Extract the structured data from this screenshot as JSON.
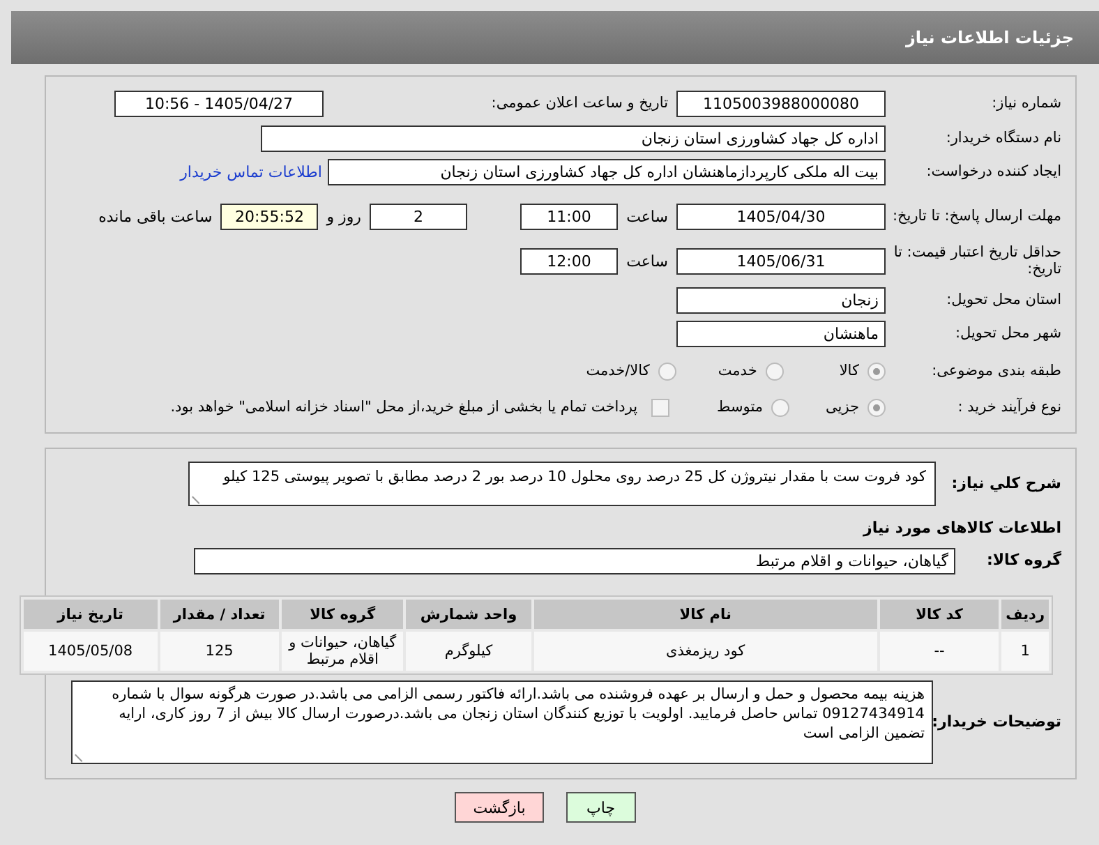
{
  "header": {
    "title": "جزئیات اطلاعات نیاز"
  },
  "need_number": {
    "label": "شماره نیاز:",
    "value": "1105003988000080"
  },
  "announce": {
    "label": "تاریخ و ساعت اعلان عمومی:",
    "value": "1405/04/27 - 10:56"
  },
  "buyer_org": {
    "label": "نام دستگاه خریدار:",
    "value": "اداره کل جهاد کشاورزی استان زنجان"
  },
  "requester": {
    "label": "ایجاد کننده درخواست:",
    "value": "بیت اله ملکی کارپردازماهنشان اداره کل جهاد کشاورزی استان زنجان",
    "link": "اطلاعات تماس خریدار"
  },
  "reply_deadline": {
    "label": "مهلت ارسال پاسخ: تا تاریخ:",
    "date": "1405/04/30",
    "time_label": "ساعت",
    "time": "11:00",
    "days": "2",
    "days_label": "روز و",
    "remaining": "20:55:52",
    "remaining_label": "ساعت باقی مانده"
  },
  "price_validity": {
    "label": "حداقل تاریخ اعتبار قیمت: تا تاریخ:",
    "date": "1405/06/31",
    "time_label": "ساعت",
    "time": "12:00"
  },
  "province": {
    "label": "استان محل تحویل:",
    "value": "زنجان"
  },
  "city": {
    "label": "شهر محل تحویل:",
    "value": "ماهنشان"
  },
  "category": {
    "label": "طبقه بندی موضوعی:",
    "options": [
      {
        "label": "کالا",
        "selected": true
      },
      {
        "label": "خدمت",
        "selected": false
      },
      {
        "label": "کالا/خدمت",
        "selected": false
      }
    ]
  },
  "purchase_process": {
    "label": "نوع فرآیند خرید :",
    "options": [
      {
        "label": "جزیی",
        "selected": true
      },
      {
        "label": "متوسط",
        "selected": false
      }
    ],
    "treasury": {
      "checked": false,
      "label": "پرداخت تمام یا بخشی از مبلغ خرید،از محل \"اسناد خزانه اسلامی\" خواهد بود."
    }
  },
  "description": {
    "label": "شرح کلي نياز:",
    "value": "کود فروت ست با مقدار نیتروژن کل 25 درصد روی محلول 10 درصد بور 2 درصد مطابق با تصویر پیوستی 125 کیلو"
  },
  "goods_heading": "اطلاعات کالاهای مورد نیاز",
  "goods_group": {
    "label": "گروه کالا:",
    "value": "گیاهان، حیوانات و اقلام مرتبط"
  },
  "table": {
    "columns": [
      "ردیف",
      "کد کالا",
      "نام کالا",
      "واحد شمارش",
      "گروه کالا",
      "تعداد / مقدار",
      "تاریخ نیاز"
    ],
    "rows": [
      [
        "1",
        "--",
        "کود ریزمغذی",
        "کیلوگرم",
        "گیاهان، حیوانات و اقلام مرتبط",
        "125",
        "1405/05/08"
      ]
    ]
  },
  "buyer_notes": {
    "label": "توضیحات خریدار:",
    "value": "هزینه بیمه محصول و حمل و ارسال بر عهده فروشنده می باشد.ارائه فاکتور رسمی الزامی می باشد.در صورت هرگونه سوال با شماره 09127434914 تماس حاصل فرمایید. اولویت با توزیع کنندگان استان زنجان می باشد.درصورت ارسال کالا بیش از 7 روز کاری، ارایه تضمین الزامی است"
  },
  "buttons": [
    {
      "kind": "print",
      "label": "چاپ"
    },
    {
      "kind": "back",
      "label": "بازگشت"
    }
  ]
}
